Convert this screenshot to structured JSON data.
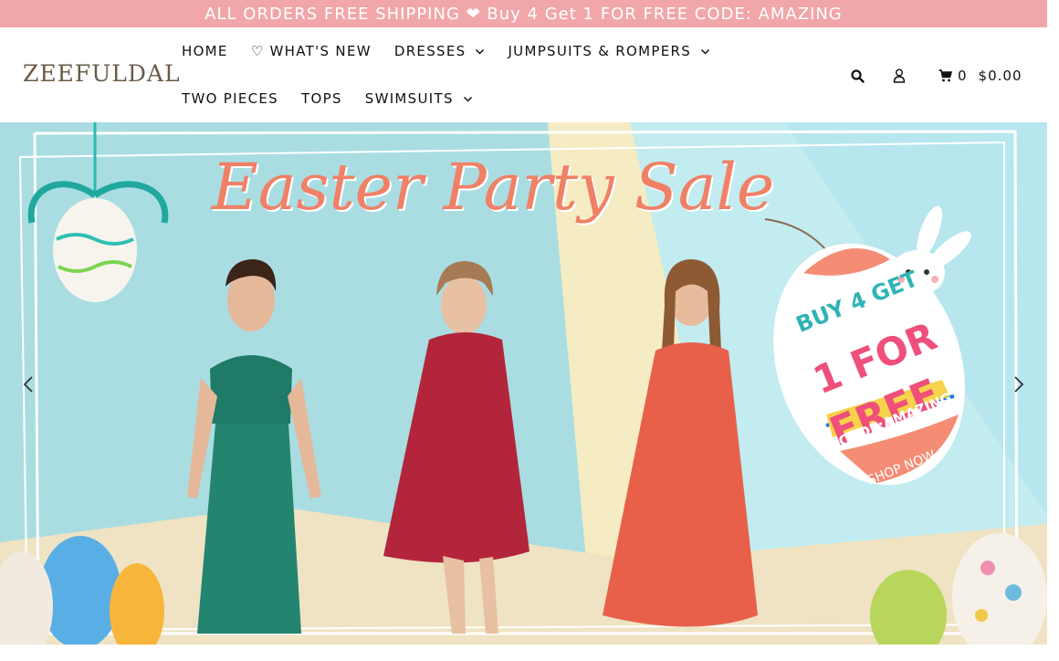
{
  "announcement": "ALL ORDERS FREE SHIPPING ❤ Buy 4 Get 1 FOR FREE CODE: AMAZING",
  "logo": "ZEEFULDAL",
  "nav": {
    "row1": [
      {
        "label": "HOME"
      },
      {
        "label": "♡ WHAT'S NEW"
      },
      {
        "label": "DRESSES"
      },
      {
        "label": "JUMPSUITS & ROMPERS"
      }
    ],
    "row2": [
      {
        "label": "TWO PIECES"
      },
      {
        "label": "TOPS"
      },
      {
        "label": "SWIMSUITS"
      }
    ]
  },
  "cart": {
    "count": "0",
    "total": "$0.00"
  },
  "icons": {
    "search": "search-icon",
    "account": "user-icon",
    "cart": "shopping-cart-icon",
    "prev": "chevron-left-icon",
    "next": "chevron-right-icon",
    "dropdown": "chevron-down-icon"
  },
  "hero": {
    "title": "Easter Party Sale",
    "tag_line1": "BUY 4 GET",
    "tag_line2": "1 FOR",
    "tag_line3": "FREE",
    "tag_code": "CODE:AMAZING",
    "tag_cta": "SHOP NOW >"
  },
  "colors": {
    "announce_bg": "#f1a7a9",
    "hero_bg": "#a9dde2",
    "accent_coral": "#f08066",
    "tag_pink": "#ef4f7a",
    "tag_teal": "#2fb3b3"
  }
}
